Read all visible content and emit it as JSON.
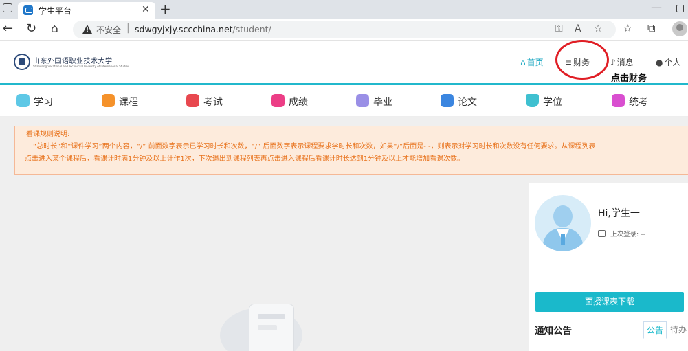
{
  "browser": {
    "tab_title": "学生平台",
    "tab_close": "✕",
    "new_tab": "+",
    "minimize": "—",
    "insecure_label": "不安全",
    "url_separator": "|",
    "url_host": "sdwgyjxjy.sccchina.net",
    "url_path": "/student/"
  },
  "header": {
    "logo_name": "山东外国语职业技术大学",
    "logo_name_en": "Shandong Vocational and Technical University of International Studies",
    "menu": [
      {
        "icon": "⌂",
        "label": "首页"
      },
      {
        "icon": "≡",
        "label": "财务"
      },
      {
        "icon": "♪",
        "label": "消息"
      },
      {
        "icon": "●",
        "label": "个人"
      }
    ],
    "annotation": "点击财务",
    "accent_color": "#21b8cc",
    "highlight_color": "#e01e25"
  },
  "categories": [
    {
      "label": "学习",
      "color": "#5ec8e6"
    },
    {
      "label": "课程",
      "color": "#f5922b"
    },
    {
      "label": "考试",
      "color": "#e8484f"
    },
    {
      "label": "成绩",
      "color": "#ec3e86"
    },
    {
      "label": "毕业",
      "color": "#9a8fe6"
    },
    {
      "label": "论文",
      "color": "#3b86e0"
    },
    {
      "label": "学位",
      "color": "#3fc0d0"
    },
    {
      "label": "统考",
      "color": "#d94fd0"
    }
  ],
  "notice": {
    "title": "看课规则说明:",
    "line1": "“总时长”和“课件学习”两个内容，“/” 前面数字表示已学习时长和次数，“/” 后面数字表示课程要求学时长和次数，如果“/”后面是- -，则表示对学习时长和次数没有任何要求。从课程列表",
    "line2": "点击进入某个课程后，看课计时满1分钟及以上计作1次，下次退出到课程列表再点击进入课程后看课计时长达到1分钟及以上才能增加看课次数。"
  },
  "profile": {
    "greeting": "Hi,学生一",
    "last_login": "上次登录: --",
    "download_button": "面授课表下载",
    "notice_heading": "通知公告",
    "notice_tabs": [
      "公告",
      "待办"
    ]
  }
}
